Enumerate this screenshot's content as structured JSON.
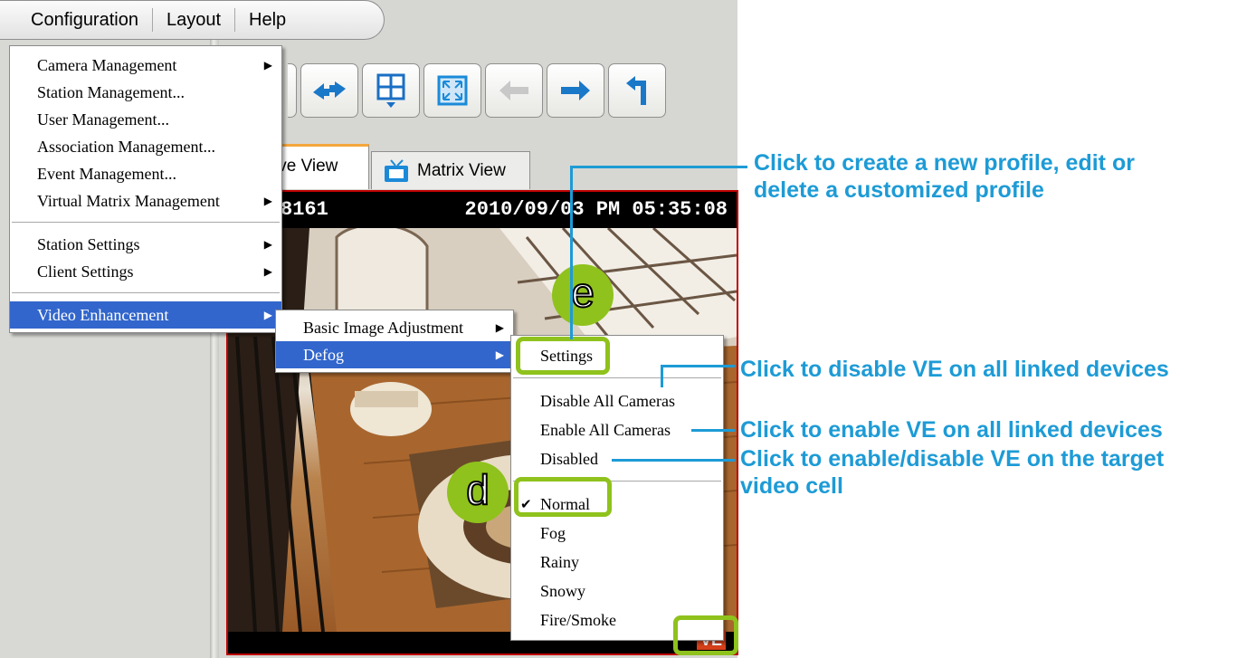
{
  "menubar": {
    "items": [
      "Configuration",
      "Layout",
      "Help"
    ]
  },
  "tabs": {
    "live_view": "ive View",
    "matrix_view": "Matrix View"
  },
  "video": {
    "camera_id": "8161",
    "timestamp": "2010/09/03 PM 05:35:08",
    "badge": "VE"
  },
  "config_menu": {
    "items": [
      "Camera Management",
      "Station Management...",
      "User Management...",
      "Association Management...",
      "Event Management...",
      "Virtual Matrix Management",
      "Station Settings",
      "Client Settings",
      "Video Enhancement"
    ]
  },
  "ve_menu": {
    "items": [
      "Basic Image Adjustment",
      "Defog"
    ]
  },
  "defog_menu": {
    "items": [
      "Settings",
      "Disable All Cameras",
      "Enable All Cameras",
      "Disabled",
      "Normal",
      "Fog",
      "Rainy",
      "Snowy",
      "Fire/Smoke"
    ],
    "checked_item": "Normal"
  },
  "markers": {
    "e": "e",
    "d": "d"
  },
  "callouts": {
    "profile_line1": "Click to create a new profile, edit or",
    "profile_line2": "delete a customized profile",
    "disable_all": "Click to disable VE on all linked devices",
    "enable_all": "Click to enable VE on all linked devices",
    "target_line1": "Click to enable/disable VE on the target",
    "target_line2": "video cell"
  },
  "colors": {
    "highlight_green": "#8fc21c",
    "callout_blue": "#1d9bd6",
    "menu_selection": "#3266cc",
    "video_border": "#c00000"
  }
}
